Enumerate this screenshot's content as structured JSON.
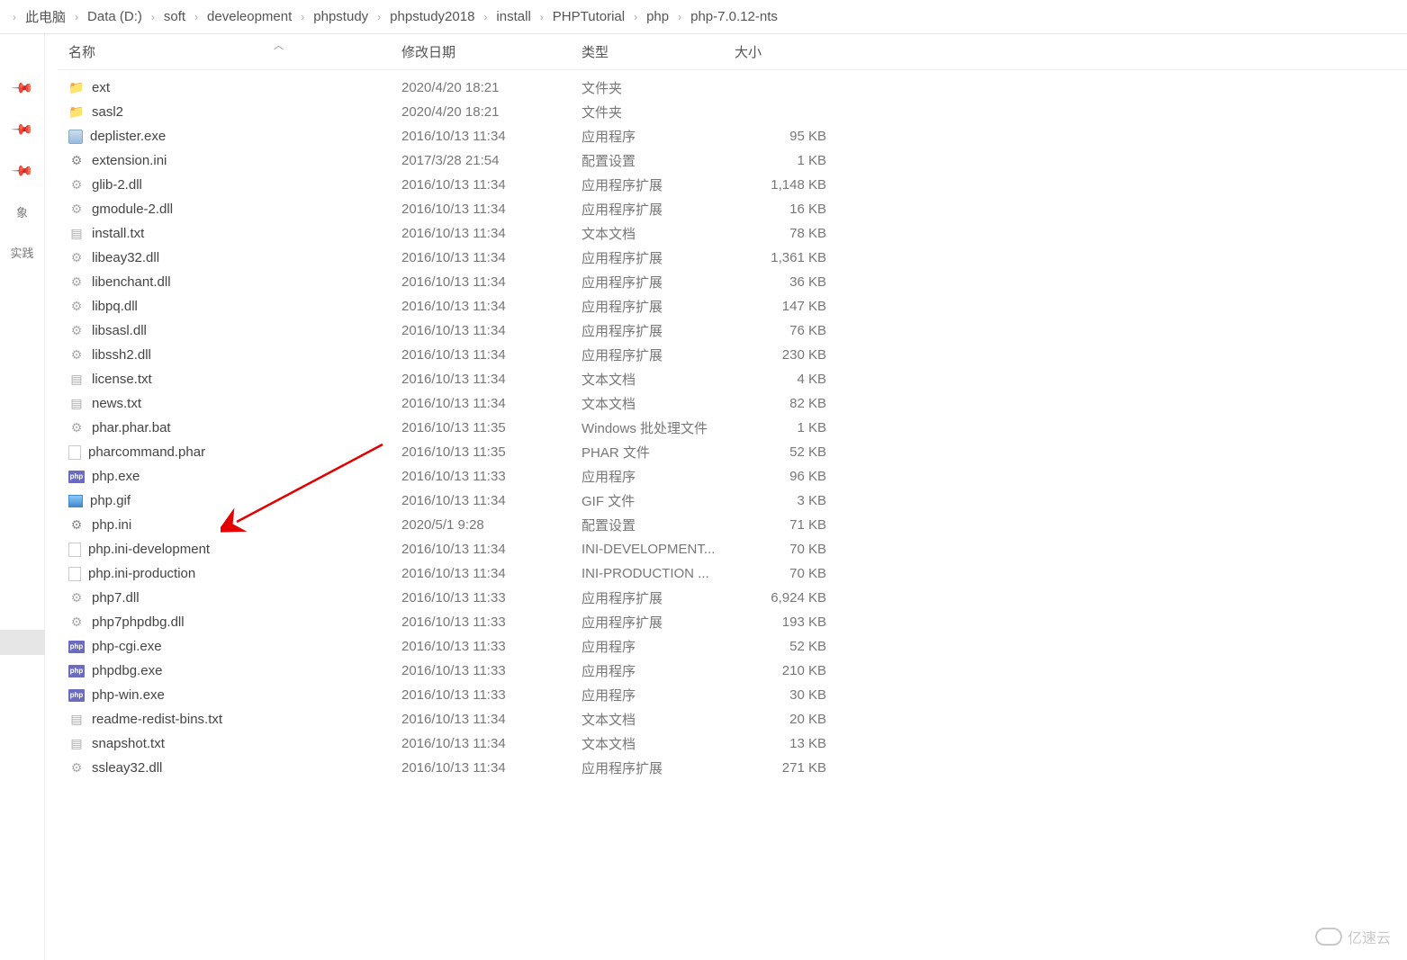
{
  "breadcrumb": [
    "此电脑",
    "Data (D:)",
    "soft",
    "develeopment",
    "phpstudy",
    "phpstudy2018",
    "install",
    "PHPTutorial",
    "php",
    "php-7.0.12-nts"
  ],
  "columns": {
    "name": "名称",
    "date": "修改日期",
    "type": "类型",
    "size": "大小"
  },
  "rail": {
    "label1": "象",
    "label2": "实践"
  },
  "watermark": "亿速云",
  "files": [
    {
      "icon": "folder",
      "name": "ext",
      "date": "2020/4/20 18:21",
      "type": "文件夹",
      "size": ""
    },
    {
      "icon": "folder",
      "name": "sasl2",
      "date": "2020/4/20 18:21",
      "type": "文件夹",
      "size": ""
    },
    {
      "icon": "exe",
      "name": "deplister.exe",
      "date": "2016/10/13 11:34",
      "type": "应用程序",
      "size": "95 KB"
    },
    {
      "icon": "ini",
      "name": "extension.ini",
      "date": "2017/3/28 21:54",
      "type": "配置设置",
      "size": "1 KB"
    },
    {
      "icon": "dll",
      "name": "glib-2.dll",
      "date": "2016/10/13 11:34",
      "type": "应用程序扩展",
      "size": "1,148 KB"
    },
    {
      "icon": "dll",
      "name": "gmodule-2.dll",
      "date": "2016/10/13 11:34",
      "type": "应用程序扩展",
      "size": "16 KB"
    },
    {
      "icon": "txt",
      "name": "install.txt",
      "date": "2016/10/13 11:34",
      "type": "文本文档",
      "size": "78 KB"
    },
    {
      "icon": "dll",
      "name": "libeay32.dll",
      "date": "2016/10/13 11:34",
      "type": "应用程序扩展",
      "size": "1,361 KB"
    },
    {
      "icon": "dll",
      "name": "libenchant.dll",
      "date": "2016/10/13 11:34",
      "type": "应用程序扩展",
      "size": "36 KB"
    },
    {
      "icon": "dll",
      "name": "libpq.dll",
      "date": "2016/10/13 11:34",
      "type": "应用程序扩展",
      "size": "147 KB"
    },
    {
      "icon": "dll",
      "name": "libsasl.dll",
      "date": "2016/10/13 11:34",
      "type": "应用程序扩展",
      "size": "76 KB"
    },
    {
      "icon": "dll",
      "name": "libssh2.dll",
      "date": "2016/10/13 11:34",
      "type": "应用程序扩展",
      "size": "230 KB"
    },
    {
      "icon": "txt",
      "name": "license.txt",
      "date": "2016/10/13 11:34",
      "type": "文本文档",
      "size": "4 KB"
    },
    {
      "icon": "txt",
      "name": "news.txt",
      "date": "2016/10/13 11:34",
      "type": "文本文档",
      "size": "82 KB"
    },
    {
      "icon": "bat",
      "name": "phar.phar.bat",
      "date": "2016/10/13 11:35",
      "type": "Windows 批处理文件",
      "size": "1 KB"
    },
    {
      "icon": "generic",
      "name": "pharcommand.phar",
      "date": "2016/10/13 11:35",
      "type": "PHAR 文件",
      "size": "52 KB"
    },
    {
      "icon": "php",
      "name": "php.exe",
      "date": "2016/10/13 11:33",
      "type": "应用程序",
      "size": "96 KB"
    },
    {
      "icon": "gif",
      "name": "php.gif",
      "date": "2016/10/13 11:34",
      "type": "GIF 文件",
      "size": "3 KB"
    },
    {
      "icon": "ini",
      "name": "php.ini",
      "date": "2020/5/1 9:28",
      "type": "配置设置",
      "size": "71 KB"
    },
    {
      "icon": "generic",
      "name": "php.ini-development",
      "date": "2016/10/13 11:34",
      "type": "INI-DEVELOPMENT...",
      "size": "70 KB"
    },
    {
      "icon": "generic",
      "name": "php.ini-production",
      "date": "2016/10/13 11:34",
      "type": "INI-PRODUCTION ...",
      "size": "70 KB"
    },
    {
      "icon": "dll",
      "name": "php7.dll",
      "date": "2016/10/13 11:33",
      "type": "应用程序扩展",
      "size": "6,924 KB"
    },
    {
      "icon": "dll",
      "name": "php7phpdbg.dll",
      "date": "2016/10/13 11:33",
      "type": "应用程序扩展",
      "size": "193 KB"
    },
    {
      "icon": "php",
      "name": "php-cgi.exe",
      "date": "2016/10/13 11:33",
      "type": "应用程序",
      "size": "52 KB"
    },
    {
      "icon": "php",
      "name": "phpdbg.exe",
      "date": "2016/10/13 11:33",
      "type": "应用程序",
      "size": "210 KB"
    },
    {
      "icon": "php",
      "name": "php-win.exe",
      "date": "2016/10/13 11:33",
      "type": "应用程序",
      "size": "30 KB"
    },
    {
      "icon": "txt",
      "name": "readme-redist-bins.txt",
      "date": "2016/10/13 11:34",
      "type": "文本文档",
      "size": "20 KB"
    },
    {
      "icon": "txt",
      "name": "snapshot.txt",
      "date": "2016/10/13 11:34",
      "type": "文本文档",
      "size": "13 KB"
    },
    {
      "icon": "dll",
      "name": "ssleay32.dll",
      "date": "2016/10/13 11:34",
      "type": "应用程序扩展",
      "size": "271 KB"
    }
  ]
}
